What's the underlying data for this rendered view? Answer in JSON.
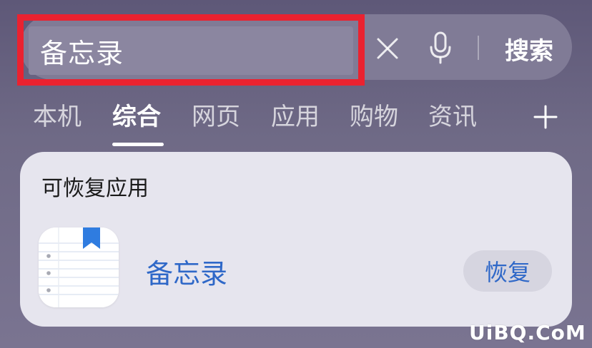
{
  "search": {
    "query": "备忘录",
    "button_label": "搜索"
  },
  "tabs": [
    {
      "label": "本机"
    },
    {
      "label": "综合",
      "active": true
    },
    {
      "label": "网页"
    },
    {
      "label": "应用"
    },
    {
      "label": "购物"
    },
    {
      "label": "资讯"
    }
  ],
  "card": {
    "title": "可恢复应用",
    "app": {
      "name": "备忘录",
      "icon": "notes-app-icon",
      "action_label": "恢复"
    }
  },
  "watermark": "UiBQ.CoM",
  "icons": {
    "clear": "close-icon",
    "voice": "microphone-icon",
    "add": "plus-icon"
  },
  "colors": {
    "highlight": "#ea2230",
    "accent": "#2f68c8",
    "card_bg": "#e6e5ee"
  }
}
